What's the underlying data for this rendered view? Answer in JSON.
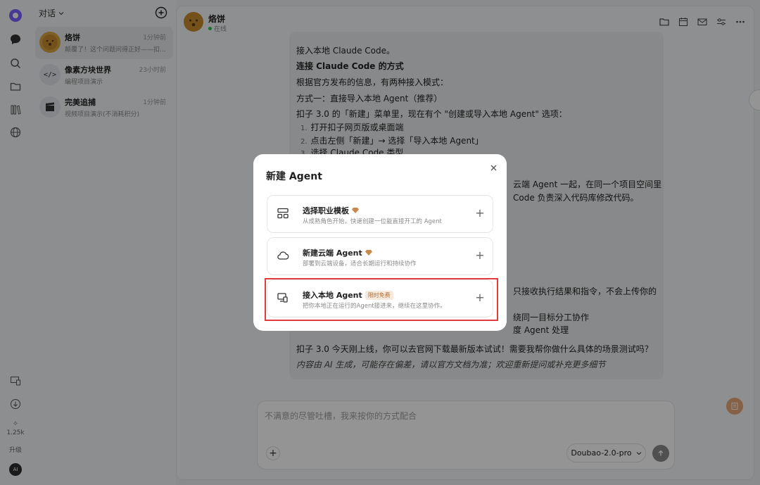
{
  "sidebar": {
    "header_label": "对话",
    "stat_value": "1.25k",
    "upgrade_label": "升级",
    "ai_badge": "AI"
  },
  "conversations": [
    {
      "name": "烙饼",
      "time": "1分钟前",
      "snippet": "颠覆了！这个问题问得正好——扣..."
    },
    {
      "name": "像素方块世界",
      "time": "23小时前",
      "snippet": "编程项目演示"
    },
    {
      "name": "完美追捕",
      "time": "1分钟前",
      "snippet": "视频项目演示(不消耗积分)"
    }
  ],
  "chat": {
    "title": "烙饼",
    "status": "在线",
    "lines": [
      "接入本地 Claude Code。",
      "连接 Claude Code 的方式",
      "根据官方发布的信息，有两种接入模式：",
      "方式一：直接导入本地 Agent（推荐）",
      "扣子 3.0 的「新建」菜单里，现在有个 \"创建或导入本地 Agent\" 选项：",
      "打开扣子网页版或桌面端",
      "点击左侧「新建」→ 选择「导入本地 Agent」",
      "选择 Claude Code 类型",
      "扣子 3.0 今天刚上线，你可以去官网下载最新版本试试！需要我帮你做什么具体的场景测试吗？",
      "内容由 AI 生成，可能存在偏差，请以官方文档为准；欢迎重新提问或补充更多细节"
    ],
    "line_nums": [
      "1.",
      "2.",
      "3."
    ],
    "partial_right": [
      "云端 Agent 一起，在同一个项目空间里",
      "Code 负责深入代码库修改代码。",
      "只接收执行结果和指令，不会上传你的",
      "绕同一目标分工协作",
      "度 Agent 处理"
    ]
  },
  "input": {
    "placeholder": "不满意的尽管吐槽，我来按你的方式配合",
    "model": "Doubao-2.0-pro"
  },
  "modal": {
    "title": "新建 Agent",
    "options": [
      {
        "title": "选择职业模板",
        "desc": "从成熟角色开始，快速创建一位能直接开工的 Agent",
        "badge": ""
      },
      {
        "title": "新建云端 Agent",
        "desc": "部署到云端设备，适合长期运行和持续协作",
        "badge": ""
      },
      {
        "title": "接入本地 Agent",
        "desc": "把你本地正在运行的Agent接进来，继续在这里协作。",
        "badge": "限时免费"
      }
    ]
  },
  "colors": {
    "highlight": "#e23b3b",
    "online": "#2bbf5a",
    "accent_orange": "#e8a878"
  }
}
